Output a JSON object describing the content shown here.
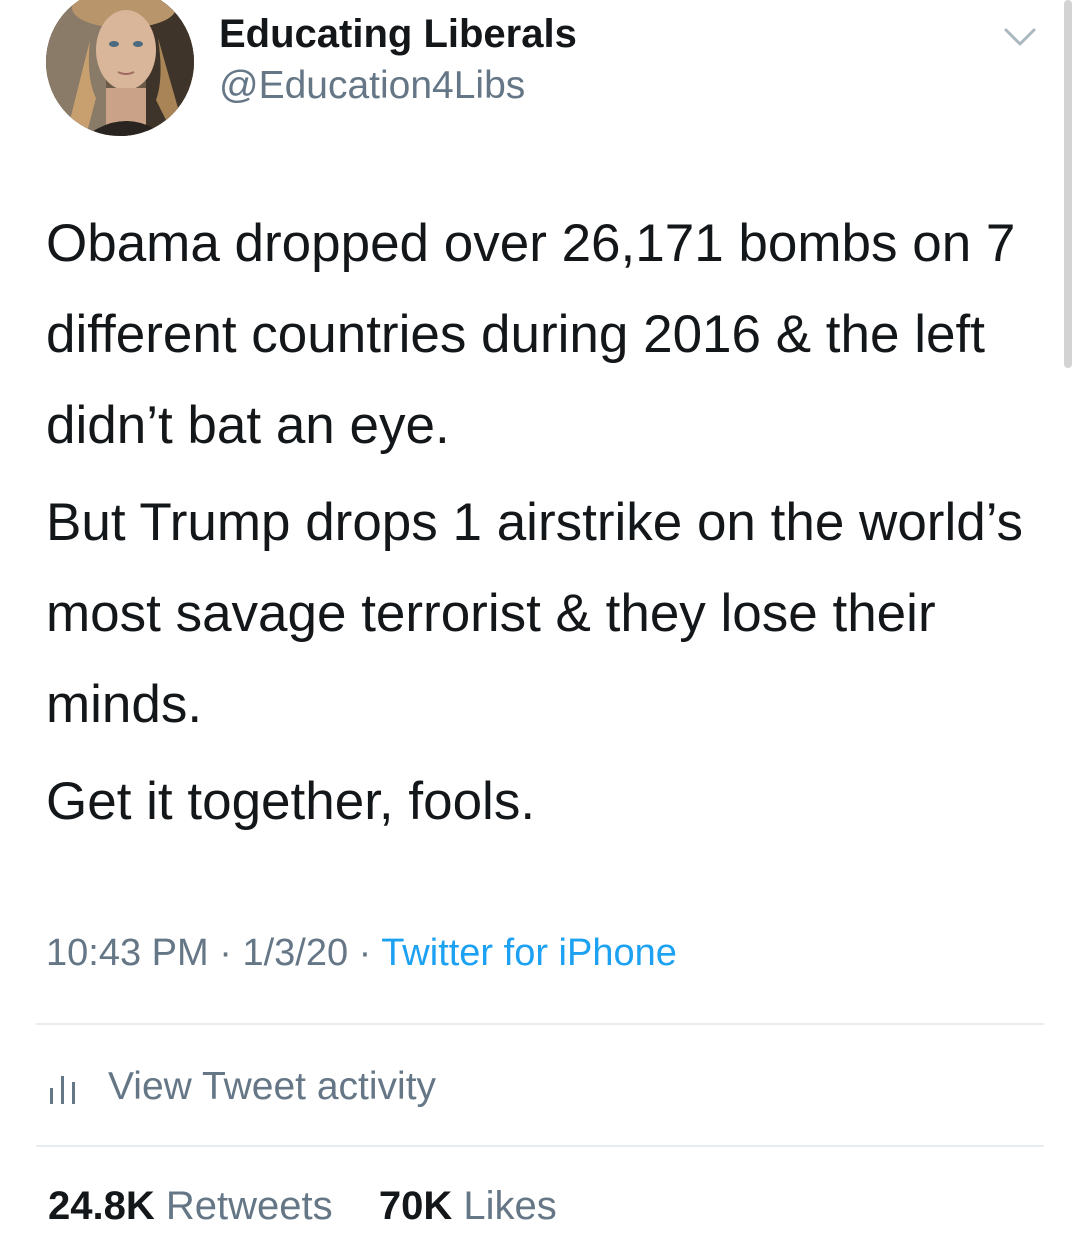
{
  "author": {
    "display_name": "Educating Liberals",
    "handle": "@Education4Libs"
  },
  "tweet": {
    "paragraphs": [
      "Obama dropped over 26,171 bombs on 7 different countries during 2016 & the left didn’t bat an eye.",
      "But Trump drops 1 airstrike on the world’s most savage terrorist & they lose their minds.",
      "Get it together, fools."
    ],
    "time": "10:43 PM",
    "date": "1/3/20",
    "separator": "·",
    "source": "Twitter for iPhone"
  },
  "activity": {
    "label": "View Tweet activity"
  },
  "stats": {
    "retweets_count": "24.8K",
    "retweets_label": "Retweets",
    "likes_count": "70K",
    "likes_label": "Likes"
  },
  "icons": {
    "menu": "chevron-down-icon",
    "activity": "bar-chart-icon"
  },
  "colors": {
    "text": "#14171a",
    "secondary": "#657786",
    "link": "#1da1f2",
    "divider": "#e6ecf0"
  }
}
